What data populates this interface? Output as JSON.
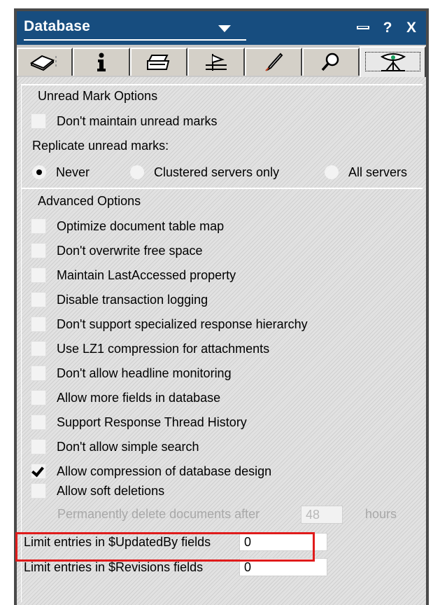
{
  "window": {
    "title": "Database",
    "help_label": "?",
    "close_label": "X"
  },
  "tabs": [
    {
      "icon": "book-icon"
    },
    {
      "icon": "info-icon"
    },
    {
      "icon": "printer-icon"
    },
    {
      "icon": "design-icon"
    },
    {
      "icon": "pen-icon"
    },
    {
      "icon": "magnifier-icon"
    },
    {
      "icon": "advanced-propeller-icon",
      "active": true
    }
  ],
  "unread": {
    "group_title": "Unread Mark Options",
    "dont_maintain": {
      "label": "Don't maintain unread marks",
      "checked": false
    },
    "replicate_label": "Replicate unread marks:",
    "options": [
      {
        "label": "Never",
        "selected": true
      },
      {
        "label": "Clustered servers only",
        "selected": false
      },
      {
        "label": "All servers",
        "selected": false
      }
    ]
  },
  "advanced": {
    "group_title": "Advanced Options",
    "options": [
      {
        "label": "Optimize document table map",
        "checked": false
      },
      {
        "label": "Don't overwrite free space",
        "checked": false
      },
      {
        "label": "Maintain LastAccessed property",
        "checked": false
      },
      {
        "label": "Disable transaction logging",
        "checked": false
      },
      {
        "label": "Don't support specialized response hierarchy",
        "checked": false
      },
      {
        "label": "Use LZ1 compression for attachments",
        "checked": false
      },
      {
        "label": "Don't allow headline monitoring",
        "checked": false
      },
      {
        "label": "Allow more fields in database",
        "checked": false
      },
      {
        "label": "Support Response Thread History",
        "checked": false
      },
      {
        "label": "Don't allow simple search",
        "checked": false
      },
      {
        "label": "Allow compression of database design",
        "checked": true
      },
      {
        "label": "Allow soft deletions",
        "checked": false
      }
    ],
    "perm_delete_label": "Permanently delete documents after",
    "perm_delete_value": "48",
    "perm_delete_unit": "hours",
    "updated_by_label": "Limit entries in $UpdatedBy fields",
    "updated_by_value": "0",
    "revisions_label": "Limit entries in $Revisions fields",
    "revisions_value": "0"
  },
  "colors": {
    "titlebar": "#174d7f",
    "highlight": "#e01b1b"
  }
}
